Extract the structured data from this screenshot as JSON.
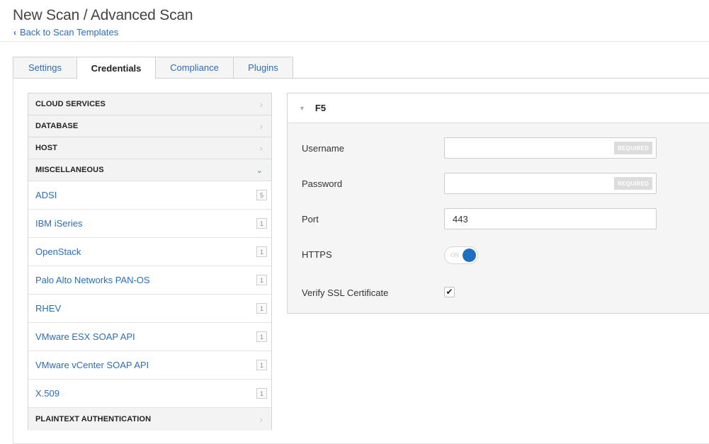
{
  "header": {
    "title": "New Scan / Advanced Scan",
    "back_label": "Back to Scan Templates"
  },
  "tabs": [
    {
      "label": "Settings"
    },
    {
      "label": "Credentials"
    },
    {
      "label": "Compliance"
    },
    {
      "label": "Plugins"
    }
  ],
  "active_tab": "Credentials",
  "sidebar": {
    "categories": {
      "cloud": "CLOUD SERVICES",
      "database": "DATABASE",
      "host": "HOST",
      "misc": "MISCELLANEOUS",
      "plaintext": "PLAINTEXT AUTHENTICATION"
    },
    "items": [
      {
        "label": "ADSI",
        "count": "5"
      },
      {
        "label": "IBM iSeries",
        "count": "1"
      },
      {
        "label": "OpenStack",
        "count": "1"
      },
      {
        "label": "Palo Alto Networks PAN-OS",
        "count": "1"
      },
      {
        "label": "RHEV",
        "count": "1"
      },
      {
        "label": "VMware ESX SOAP API",
        "count": "1"
      },
      {
        "label": "VMware vCenter SOAP API",
        "count": "1"
      },
      {
        "label": "X.509",
        "count": "1"
      }
    ]
  },
  "form": {
    "title": "F5",
    "username": {
      "label": "Username",
      "value": "",
      "badge": "REQUIRED"
    },
    "password": {
      "label": "Password",
      "value": "",
      "badge": "REQUIRED"
    },
    "port": {
      "label": "Port",
      "value": "443"
    },
    "https": {
      "label": "HTTPS",
      "state": "ON"
    },
    "verify_ssl": {
      "label": "Verify SSL Certificate",
      "checked": true,
      "mark": "✔"
    }
  },
  "colors": {
    "link": "#2a6ebb",
    "toggle_on": "#1f6fc0",
    "expanded_arrow": "#3aa63a"
  }
}
